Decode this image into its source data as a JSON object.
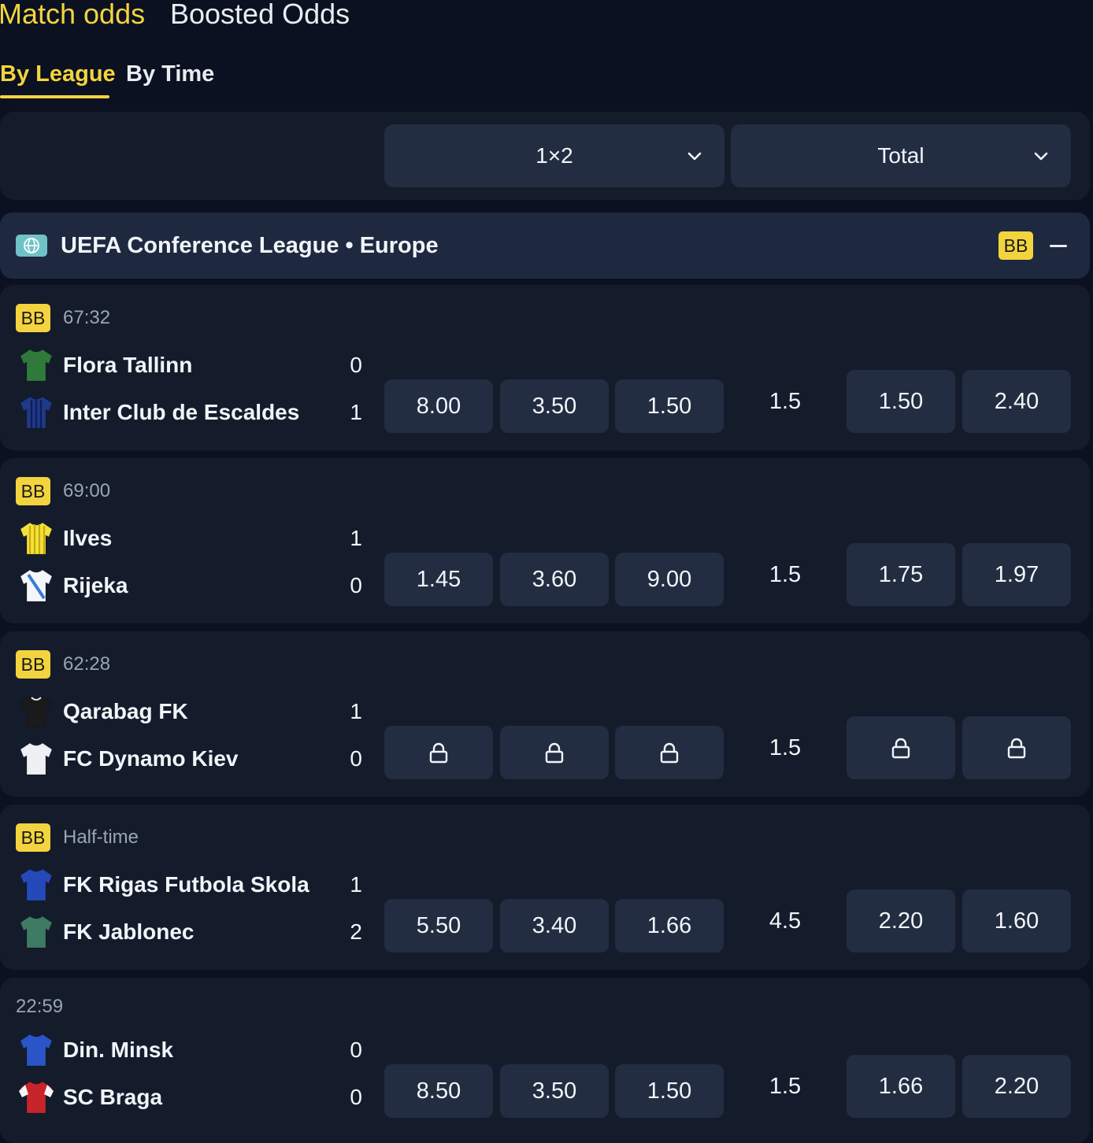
{
  "header": {
    "tab_match_odds": "Match odds",
    "tab_boosted_odds": "Boosted Odds",
    "subtab_by_league": "By League",
    "subtab_by_time": "By Time"
  },
  "markets": {
    "select_1": "1×2",
    "select_2": "Total"
  },
  "league": {
    "title": "UEFA Conference League • Europe",
    "badge": "BB",
    "icon": "globe-icon"
  },
  "matches": [
    {
      "badge": "BB",
      "status": "67:32",
      "home": {
        "name": "Flora Tallinn",
        "score": "0",
        "kit_color": "#2f7a3b"
      },
      "away": {
        "name": "Inter Club de Escaldes",
        "score": "1",
        "kit_color": "#1f3a8a"
      },
      "odds_1x2": [
        "8.00",
        "3.50",
        "1.50"
      ],
      "total_line": "1.5",
      "total_odds": [
        "1.50",
        "2.40"
      ]
    },
    {
      "badge": "BB",
      "status": "69:00",
      "home": {
        "name": "Ilves",
        "score": "1",
        "kit_color": "#f2e23a"
      },
      "away": {
        "name": "Rijeka",
        "score": "0",
        "kit_color": "#f4f6fa"
      },
      "odds_1x2": [
        "1.45",
        "3.60",
        "9.00"
      ],
      "total_line": "1.5",
      "total_odds": [
        "1.75",
        "1.97"
      ]
    },
    {
      "badge": "BB",
      "status": "62:28",
      "home": {
        "name": "Qarabag FK",
        "score": "1",
        "kit_color": "#1a1a1a"
      },
      "away": {
        "name": "FC Dynamo Kiev",
        "score": "0",
        "kit_color": "#eef0f4"
      },
      "locked": true,
      "total_line": "1.5"
    },
    {
      "badge": "BB",
      "status": "Half-time",
      "home": {
        "name": "FK Rigas Futbola Skola",
        "score": "1",
        "kit_color": "#2549b8"
      },
      "away": {
        "name": "FK Jablonec",
        "score": "2",
        "kit_color": "#3f7a64"
      },
      "odds_1x2": [
        "5.50",
        "3.40",
        "1.66"
      ],
      "total_line": "4.5",
      "total_odds": [
        "2.20",
        "1.60"
      ]
    },
    {
      "badge": "",
      "status": "22:59",
      "home": {
        "name": "Din. Minsk",
        "score": "0",
        "kit_color": "#2a55c8"
      },
      "away": {
        "name": "SC Braga",
        "score": "0",
        "kit_color": "#c8242b"
      },
      "odds_1x2": [
        "8.50",
        "3.50",
        "1.50"
      ],
      "total_line": "1.5",
      "total_odds": [
        "1.66",
        "2.20"
      ]
    }
  ]
}
